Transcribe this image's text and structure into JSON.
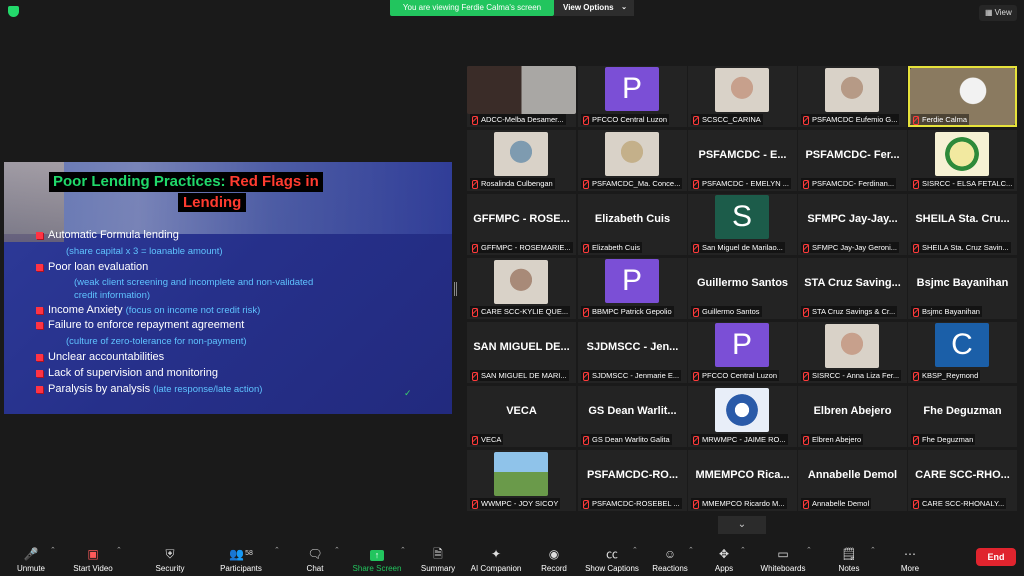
{
  "banner": {
    "viewing": "You are viewing Ferdie Calma's screen",
    "view_options": "View Options",
    "view": "View"
  },
  "slide": {
    "title1_green": "Poor Lending Practices:",
    "title1_red": "Red Flags in",
    "title2": "Lending",
    "items": [
      {
        "text": "Automatic Formula lending",
        "note": "",
        "sub": "(share capital x 3 = loanable amount)"
      },
      {
        "text": "Poor loan evaluation",
        "note": "",
        "sub": "(weak client screening and incomplete and non-validated",
        "sub2": "credit information)"
      },
      {
        "text": "Income Anxiety",
        "note": "(focus on income not credit risk)"
      },
      {
        "text": "Failure to enforce repayment agreement",
        "note": "",
        "sub": "(culture of zero-tolerance for non-payment)"
      },
      {
        "text": "Unclear accountabilities",
        "note": ""
      },
      {
        "text": "Lack of supervision and monitoring",
        "note": ""
      },
      {
        "text": "Paralysis by analysis",
        "note": "(late response/late action)"
      }
    ]
  },
  "participants": [
    {
      "label": "ADCC-Melba Desamer...",
      "name": "",
      "kind": "video"
    },
    {
      "label": "PFCCO Central Luzon",
      "name": "",
      "kind": "avatar",
      "letter": "P"
    },
    {
      "label": "SCSCC_CARINA",
      "name": "",
      "kind": "video"
    },
    {
      "label": "PSFAMCDC Eufemio G...",
      "name": "",
      "kind": "video"
    },
    {
      "label": "Ferdie Calma",
      "name": "",
      "kind": "video",
      "active": true
    },
    {
      "label": "Rosalinda Culbengan",
      "name": "",
      "kind": "video"
    },
    {
      "label": "PSFAMCDC_Ma. Conce...",
      "name": "",
      "kind": "video"
    },
    {
      "label": "PSFAMCDC - EMELYN ...",
      "name": "PSFAMCDC - E...",
      "kind": "name"
    },
    {
      "label": "PSFAMCDC- Ferdinan...",
      "name": "PSFAMCDC- Fer...",
      "kind": "name"
    },
    {
      "label": "SISRCC - ELSA FETALC...",
      "name": "",
      "kind": "logo"
    },
    {
      "label": "GFFMPC - ROSEMARIE...",
      "name": "GFFMPC - ROSE...",
      "kind": "name"
    },
    {
      "label": "Elizabeth Cuis",
      "name": "Elizabeth Cuis",
      "kind": "name"
    },
    {
      "label": "San Miguel de Marilao...",
      "name": "",
      "kind": "avatar",
      "letter": "S"
    },
    {
      "label": "SFMPC Jay-Jay Geroni...",
      "name": "SFMPC Jay-Jay...",
      "kind": "name"
    },
    {
      "label": "SHEILA Sta. Cruz Savin...",
      "name": "SHEILA Sta. Cru...",
      "kind": "name"
    },
    {
      "label": "CARE SCC-KYLIE QUE...",
      "name": "",
      "kind": "video"
    },
    {
      "label": "BBMPC Patrick Gepolio",
      "name": "",
      "kind": "avatar",
      "letter": "P"
    },
    {
      "label": "Guillermo Santos",
      "name": "Guillermo Santos",
      "kind": "name"
    },
    {
      "label": "STA Cruz Savings & Cr...",
      "name": "STA Cruz Saving...",
      "kind": "name"
    },
    {
      "label": "Bsjmc Bayanihan",
      "name": "Bsjmc Bayanihan",
      "kind": "name"
    },
    {
      "label": "SAN MIGUEL DE MARI...",
      "name": "SAN MIGUEL DE...",
      "kind": "name"
    },
    {
      "label": "SJDMSCC - Jenmarie E...",
      "name": "SJDMSCC - Jen...",
      "kind": "name"
    },
    {
      "label": "PFCCO Central Luzon",
      "name": "",
      "kind": "avatar",
      "letter": "P"
    },
    {
      "label": "SISRCC - Anna Liza Fer...",
      "name": "",
      "kind": "video"
    },
    {
      "label": "KBSP_Reymond",
      "name": "",
      "kind": "avatar",
      "letter": "C",
      "color": "c"
    },
    {
      "label": "VECA",
      "name": "VECA",
      "kind": "name"
    },
    {
      "label": "GS Dean Warlito Galita",
      "name": "GS Dean Warlit...",
      "kind": "name"
    },
    {
      "label": "MRWMPC - JAIME RO...",
      "name": "",
      "kind": "logo2"
    },
    {
      "label": "Elbren Abejero",
      "name": "Elbren Abejero",
      "kind": "name"
    },
    {
      "label": "Fhe Deguzman",
      "name": "Fhe Deguzman",
      "kind": "name"
    },
    {
      "label": "WWMPC - JOY SICOY",
      "name": "",
      "kind": "video"
    },
    {
      "label": "PSFAMCDC-ROSEBEL ...",
      "name": "PSFAMCDC-RO...",
      "kind": "name"
    },
    {
      "label": "MMEMPCO Ricardo M...",
      "name": "MMEMPCO Rica...",
      "kind": "name"
    },
    {
      "label": "Annabelle Demol",
      "name": "Annabelle Demol",
      "kind": "name"
    },
    {
      "label": "CARE SCC-RHONALY...",
      "name": "CARE SCC-RHO...",
      "kind": "name"
    }
  ],
  "toolbar": {
    "unmute": "Unmute",
    "start_video": "Start Video",
    "security": "Security",
    "participants": "Participants",
    "participants_count": "58",
    "chat": "Chat",
    "share_screen": "Share Screen",
    "summary": "Summary",
    "ai_companion": "AI Companion",
    "record": "Record",
    "show_captions": "Show Captions",
    "reactions": "Reactions",
    "apps": "Apps",
    "whiteboards": "Whiteboards",
    "notes": "Notes",
    "more": "More",
    "end": "End"
  },
  "colors": {
    "accent_green": "#22c55e",
    "end_red": "#e0242e",
    "active_speaker": "#e6e23a"
  }
}
